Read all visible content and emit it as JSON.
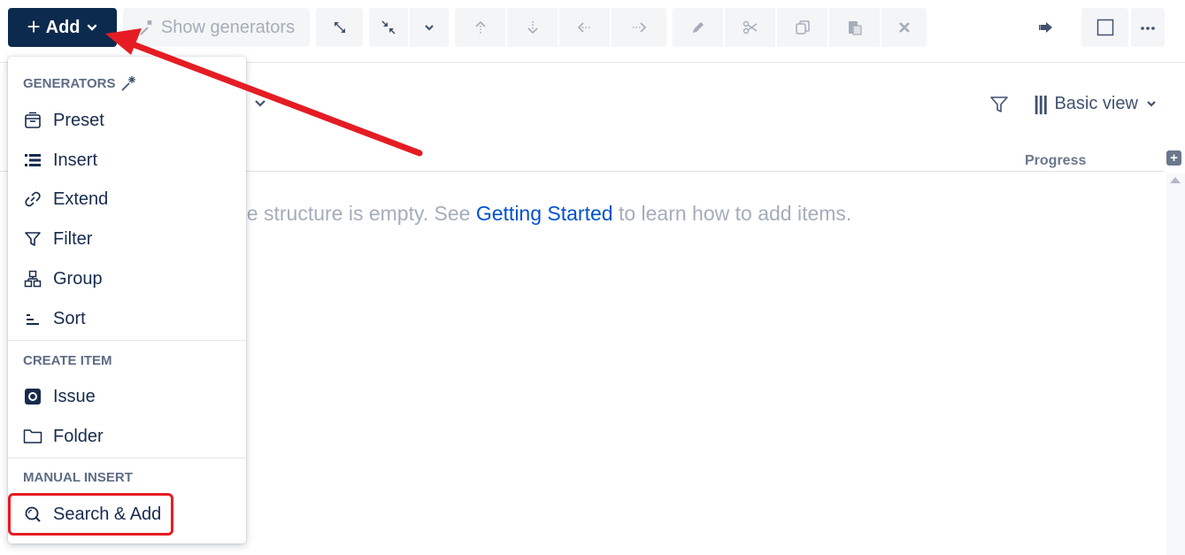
{
  "toolbar": {
    "add_label": "Add",
    "show_generators_label": "Show generators",
    "buttons": [
      "expand-icon",
      "collapse-icon",
      "chevron-down-icon",
      "move-up-icon",
      "move-down-icon",
      "move-left-icon",
      "move-right-icon",
      "pencil-icon",
      "scissors-icon",
      "copy-icon",
      "paste-icon",
      "close-icon"
    ],
    "right_buttons": [
      "export-icon",
      "panel-icon",
      "more-icon"
    ]
  },
  "view": {
    "basic_view_label": "Basic view"
  },
  "columns": {
    "progress_label": "Progress"
  },
  "empty": {
    "prefix": "he structure is empty. See ",
    "link": "Getting Started",
    "suffix": " to learn how to add items."
  },
  "menu": {
    "generators_title": "GENERATORS",
    "generators": [
      {
        "label": "Preset",
        "icon": "preset-icon"
      },
      {
        "label": "Insert",
        "icon": "insert-icon"
      },
      {
        "label": "Extend",
        "icon": "link-icon"
      },
      {
        "label": "Filter",
        "icon": "filter-icon"
      },
      {
        "label": "Group",
        "icon": "group-icon"
      },
      {
        "label": "Sort",
        "icon": "sort-icon"
      }
    ],
    "create_title": "CREATE ITEM",
    "create": [
      {
        "label": "Issue",
        "icon": "issue-icon"
      },
      {
        "label": "Folder",
        "icon": "folder-icon"
      }
    ],
    "manual_title": "MANUAL INSERT",
    "manual": [
      {
        "label": "Search & Add",
        "icon": "search-icon"
      }
    ]
  },
  "colors": {
    "primary_dark": "#0c2a4d",
    "link": "#0052cc",
    "annotation_red": "#e51c23"
  }
}
